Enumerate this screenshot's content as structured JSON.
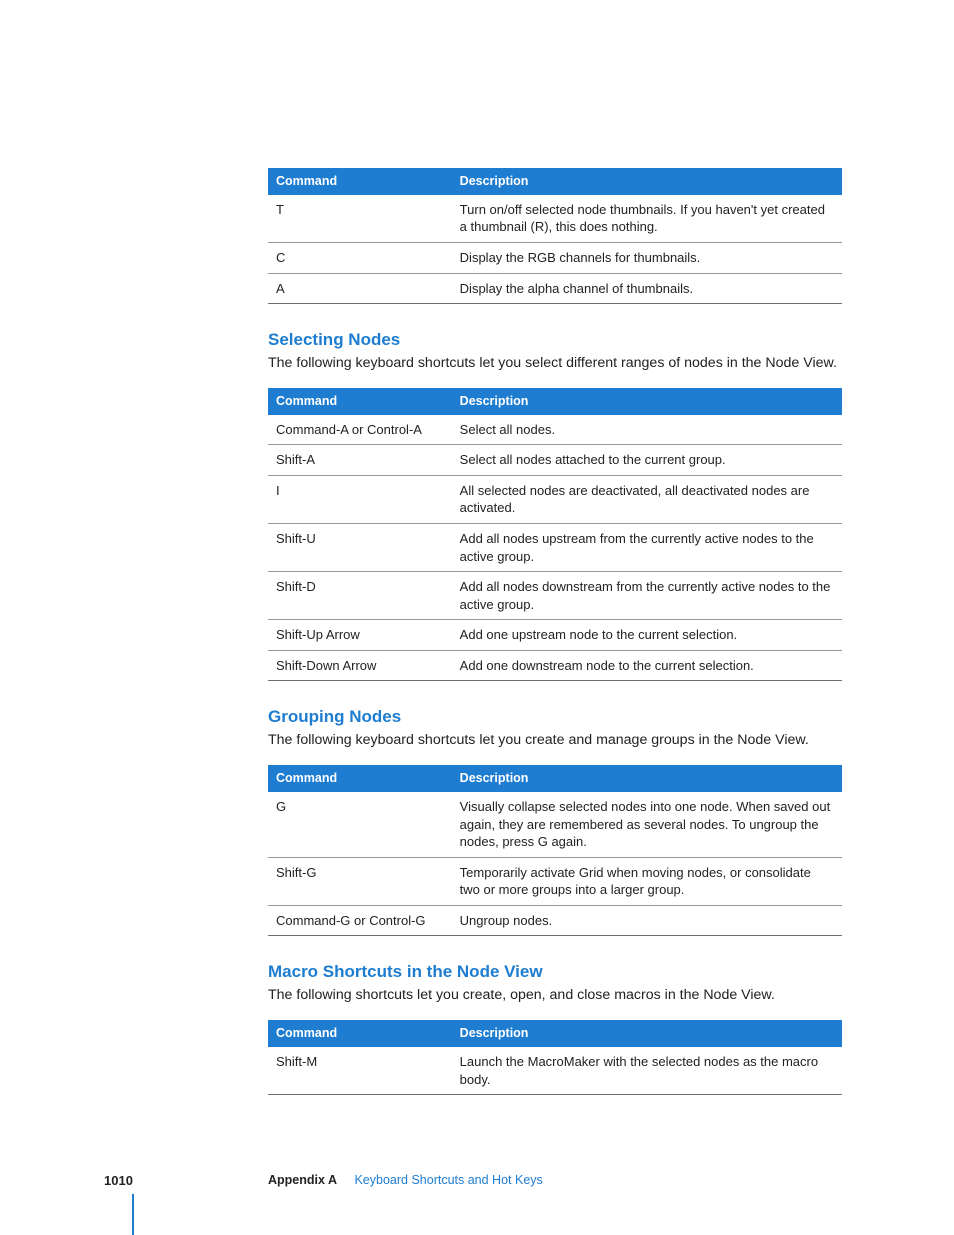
{
  "tables": {
    "t1": {
      "headers": {
        "c": "Command",
        "d": "Description"
      },
      "rows": [
        {
          "c": "T",
          "d": "Turn on/off selected node thumbnails. If you haven't yet created a thumbnail (R), this does nothing."
        },
        {
          "c": "C",
          "d": "Display the RGB channels for thumbnails."
        },
        {
          "c": "A",
          "d": "Display the alpha channel of thumbnails."
        }
      ]
    },
    "t2": {
      "headers": {
        "c": "Command",
        "d": "Description"
      },
      "rows": [
        {
          "c": "Command-A or Control-A",
          "d": "Select all nodes."
        },
        {
          "c": "Shift-A",
          "d": "Select all nodes attached to the current group."
        },
        {
          "c": "I",
          "d": "All selected nodes are deactivated, all deactivated nodes are activated."
        },
        {
          "c": "Shift-U",
          "d": "Add all nodes upstream from the currently active nodes to the active group."
        },
        {
          "c": "Shift-D",
          "d": "Add all nodes downstream from the currently active nodes to the active group."
        },
        {
          "c": "Shift-Up Arrow",
          "d": "Add one upstream node to the current selection."
        },
        {
          "c": "Shift-Down Arrow",
          "d": "Add one downstream node to the current selection."
        }
      ]
    },
    "t3": {
      "headers": {
        "c": "Command",
        "d": "Description"
      },
      "rows": [
        {
          "c": "G",
          "d": "Visually collapse selected nodes into one node. When saved out again, they are remembered as several nodes. To ungroup the nodes, press G again."
        },
        {
          "c": "Shift-G",
          "d": "Temporarily activate Grid when moving nodes, or consolidate two or more groups into a larger group."
        },
        {
          "c": "Command-G or Control-G",
          "d": "Ungroup nodes."
        }
      ]
    },
    "t4": {
      "headers": {
        "c": "Command",
        "d": "Description"
      },
      "rows": [
        {
          "c": "Shift-M",
          "d": "Launch the MacroMaker with the selected nodes as the macro body."
        }
      ]
    }
  },
  "sections": {
    "s1": {
      "h": "Selecting Nodes",
      "p": "The following keyboard shortcuts let you select different ranges of nodes in the Node View."
    },
    "s2": {
      "h": "Grouping Nodes",
      "p": "The following keyboard shortcuts let you create and manage groups in the Node View."
    },
    "s3": {
      "h": "Macro Shortcuts in the Node View",
      "p": "The following shortcuts let you create, open, and close macros in the Node View."
    }
  },
  "footer": {
    "page": "1010",
    "appendix": "Appendix A",
    "title": "Keyboard Shortcuts and Hot Keys"
  }
}
